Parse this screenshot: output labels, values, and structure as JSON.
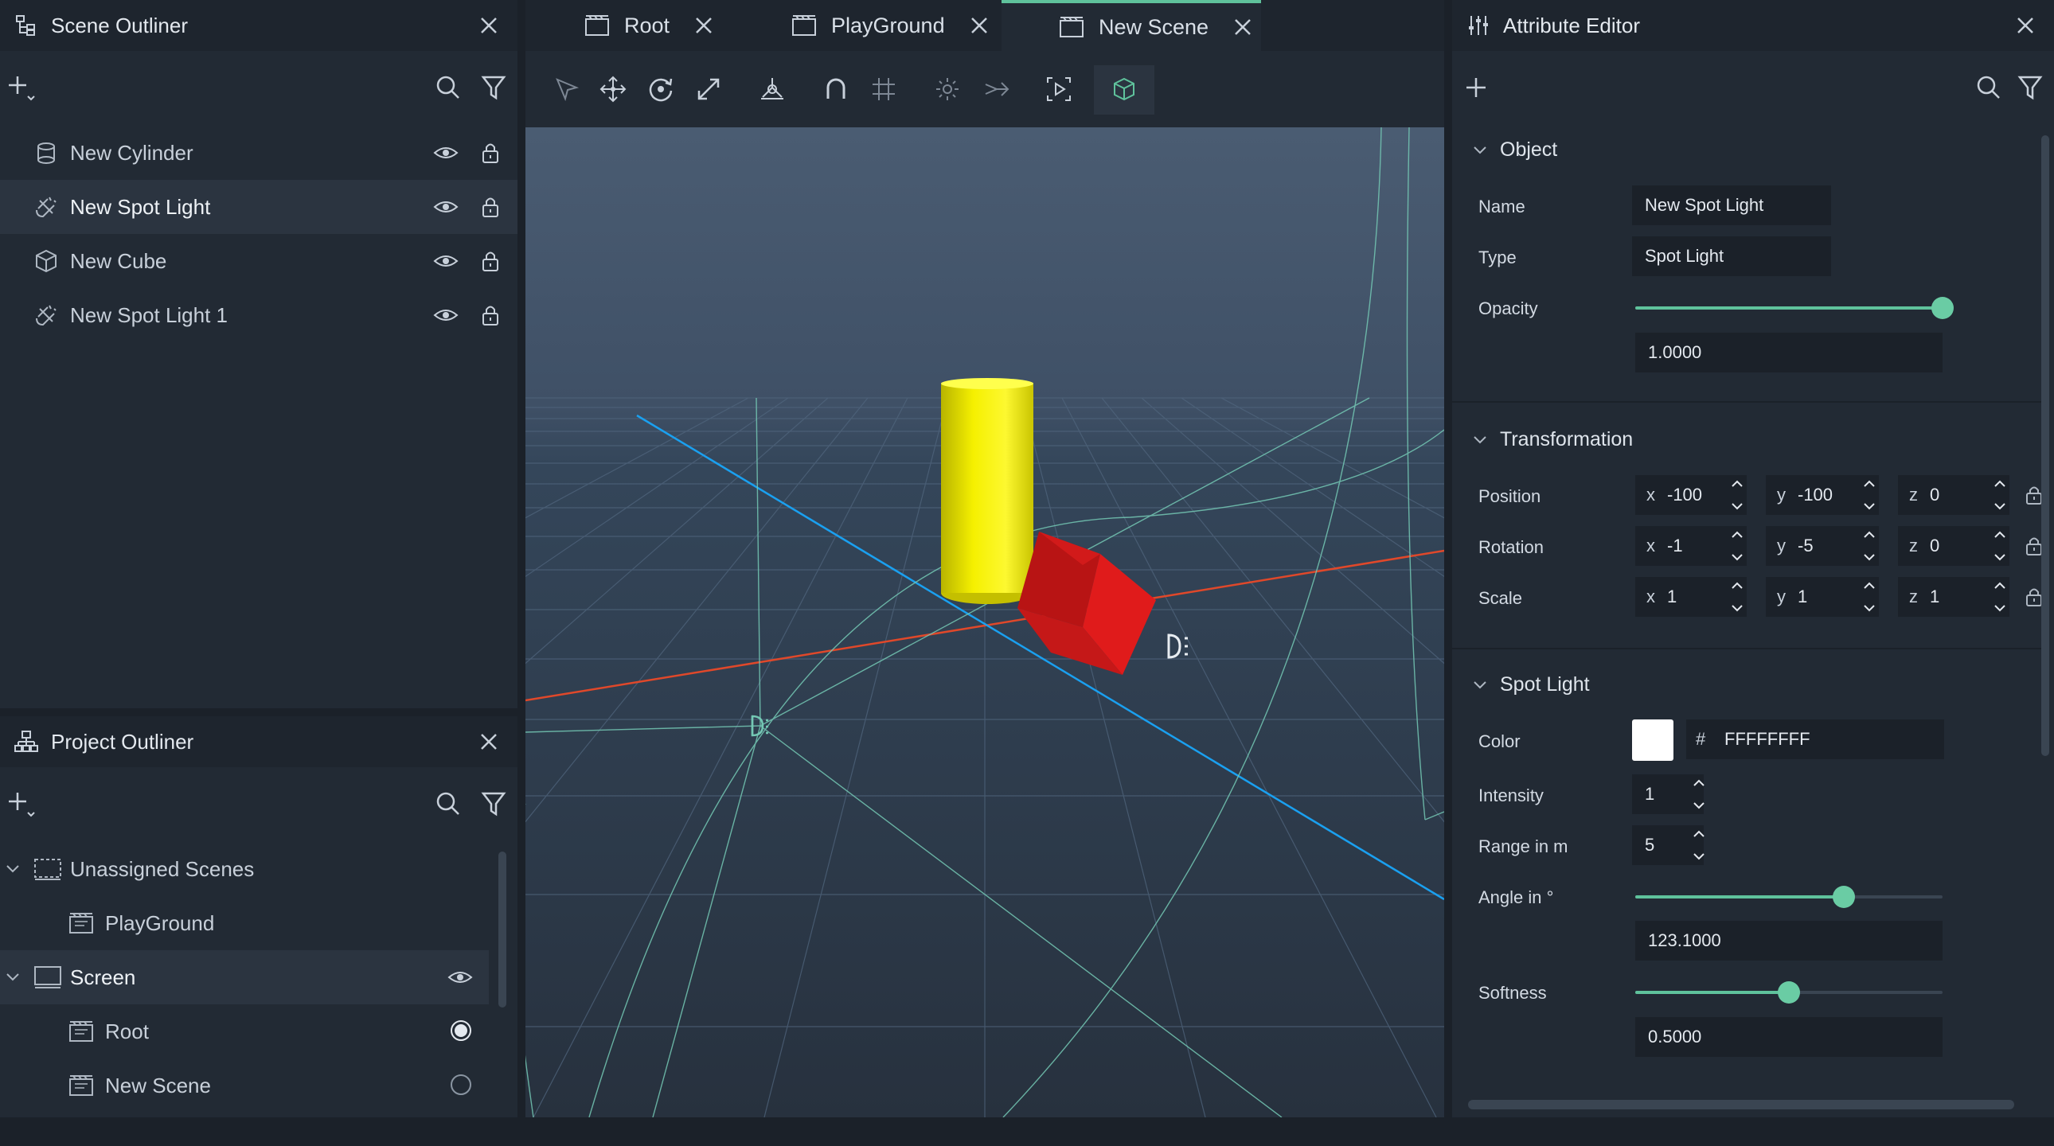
{
  "scene_outliner": {
    "title": "Scene Outliner",
    "items": [
      {
        "label": "New Cylinder"
      },
      {
        "label": "New Spot Light"
      },
      {
        "label": "New Cube"
      },
      {
        "label": "New Spot Light 1"
      }
    ]
  },
  "project_outliner": {
    "title": "Project Outliner",
    "items": [
      {
        "label": "Unassigned Scenes"
      },
      {
        "label": "PlayGround"
      },
      {
        "label": "Screen"
      },
      {
        "label": "Root"
      },
      {
        "label": "New Scene"
      }
    ]
  },
  "tabs": [
    {
      "label": "Root"
    },
    {
      "label": "PlayGround"
    },
    {
      "label": "New Scene",
      "active": true
    }
  ],
  "attribute_editor": {
    "title": "Attribute Editor",
    "object": {
      "header": "Object",
      "name_label": "Name",
      "name_value": "New Spot Light",
      "type_label": "Type",
      "type_value": "Spot Light",
      "opacity_label": "Opacity",
      "opacity_value": "1.0000",
      "opacity_level": 1.0
    },
    "transformation": {
      "header": "Transformation",
      "position_label": "Position",
      "rotation_label": "Rotation",
      "scale_label": "Scale",
      "axis_x": "x",
      "axis_y": "y",
      "axis_z": "z",
      "position": {
        "x": "-100",
        "y": "-100",
        "z": "0"
      },
      "rotation": {
        "x": "-1",
        "y": "-5",
        "z": "0"
      },
      "scale": {
        "x": "1",
        "y": "1",
        "z": "1"
      }
    },
    "spot_light": {
      "header": "Spot Light",
      "color_label": "Color",
      "color_hash": "#",
      "color_value": "FFFFFFFF",
      "intensity_label": "Intensity",
      "intensity_value": "1",
      "range_label": "Range in m",
      "range_value": "5",
      "angle_label": "Angle in °",
      "angle_value": "123.1000",
      "angle_level": 0.68,
      "softness_label": "Softness",
      "softness_value": "0.5000",
      "softness_level": 0.5
    }
  },
  "colors": {
    "accent": "#5fc29c",
    "cylinder": "#f5f000",
    "cube": "#e01b1b",
    "x_axis": "#e0482a",
    "z_axis": "#1aa0f0"
  }
}
